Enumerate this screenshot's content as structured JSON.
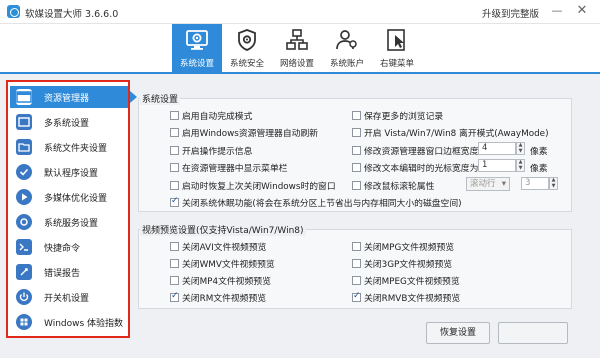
{
  "window": {
    "title": "软媒设置大师 3.6.6.0",
    "upgrade_link": "升级到完整版",
    "minimize": "—",
    "close": "✕"
  },
  "tabs": [
    {
      "label": "系统设置",
      "icon": "monitor-gear-icon",
      "active": true
    },
    {
      "label": "系统安全",
      "icon": "shield-gear-icon",
      "active": false
    },
    {
      "label": "网络设置",
      "icon": "network-icon",
      "active": false
    },
    {
      "label": "系统账户",
      "icon": "users-icon",
      "active": false
    },
    {
      "label": "右键菜单",
      "icon": "cursor-icon",
      "active": false
    }
  ],
  "sidebar": {
    "items": [
      {
        "label": "资源管理器",
        "icon": "explorer-icon",
        "active": true
      },
      {
        "label": "多系统设置",
        "icon": "multi-system-icon",
        "active": false
      },
      {
        "label": "系统文件夹设置",
        "icon": "folder-settings-icon",
        "active": false
      },
      {
        "label": "默认程序设置",
        "icon": "default-programs-icon",
        "active": false
      },
      {
        "label": "多媒体优化设置",
        "icon": "multimedia-icon",
        "active": false
      },
      {
        "label": "系统服务设置",
        "icon": "services-icon",
        "active": false
      },
      {
        "label": "快捷命令",
        "icon": "quick-command-icon",
        "active": false
      },
      {
        "label": "错误报告",
        "icon": "error-report-icon",
        "active": false
      },
      {
        "label": "开关机设置",
        "icon": "power-icon",
        "active": false
      },
      {
        "label": "Windows 体验指数",
        "icon": "windows-experience-icon",
        "active": false
      }
    ]
  },
  "system_settings": {
    "title": "系统设置",
    "left": [
      {
        "label": "启用自动完成模式",
        "checked": false
      },
      {
        "label": "启用Windows资源管理器自动刷新",
        "checked": false
      },
      {
        "label": "开启操作提示信息",
        "checked": false
      },
      {
        "label": "在资源管理器中显示菜单栏",
        "checked": false
      },
      {
        "label": "启动时恢复上次关闭Windows时的窗口",
        "checked": false
      }
    ],
    "right": [
      {
        "label": "保存更多的浏览记录",
        "checked": false
      },
      {
        "label": "开启 Vista/Win7/Win8 离开模式(AwayMode)",
        "checked": false
      },
      {
        "label": "修改资源管理器窗口边框宽度",
        "checked": false
      },
      {
        "label": "修改文本编辑时的光标宽度为",
        "checked": false
      },
      {
        "label": "修改鼠标滚轮属性",
        "checked": false
      }
    ],
    "border_width": {
      "value": "4",
      "unit": "像素"
    },
    "cursor_width": {
      "value": "1",
      "unit": "像素"
    },
    "wheel_mode": "滚动行",
    "wheel_lines": "3",
    "full_row": {
      "label": "关闭系统休眠功能(将会在系统分区上节省出与内存相同大小的磁盘空间)",
      "checked": true
    }
  },
  "video_preview": {
    "title": "视频预览设置(仅支持Vista/Win7/Win8)",
    "left": [
      {
        "label": "关闭AVI文件视频预览",
        "checked": false
      },
      {
        "label": "关闭WMV文件视频预览",
        "checked": false
      },
      {
        "label": "关闭MP4文件视频预览",
        "checked": false
      },
      {
        "label": "关闭RM文件视频预览",
        "checked": true
      }
    ],
    "right": [
      {
        "label": "关闭MPG文件视频预览",
        "checked": false
      },
      {
        "label": "关闭3GP文件视频预览",
        "checked": false
      },
      {
        "label": "关闭MPEG文件视频预览",
        "checked": false
      },
      {
        "label": "关闭RMVB文件视频预览",
        "checked": true
      }
    ]
  },
  "buttons": {
    "restore": "恢复设置"
  },
  "colors": {
    "accent": "#2f8bd9",
    "highlight_border": "#e0281b"
  }
}
